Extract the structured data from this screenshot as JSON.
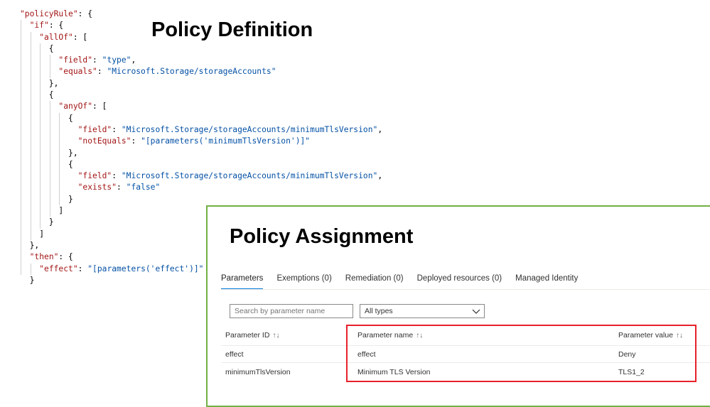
{
  "definition": {
    "title": "Policy Definition",
    "code_lines": [
      [
        {
          "t": "k",
          "v": "\"policyRule\""
        },
        {
          "t": "p",
          "v": ": {"
        }
      ],
      [
        {
          "t": "p",
          "v": "  "
        },
        {
          "t": "k",
          "v": "\"if\""
        },
        {
          "t": "p",
          "v": ": {"
        }
      ],
      [
        {
          "t": "p",
          "v": "    "
        },
        {
          "t": "k",
          "v": "\"allOf\""
        },
        {
          "t": "p",
          "v": ": ["
        }
      ],
      [
        {
          "t": "p",
          "v": "      {"
        }
      ],
      [
        {
          "t": "p",
          "v": "        "
        },
        {
          "t": "k",
          "v": "\"field\""
        },
        {
          "t": "p",
          "v": ": "
        },
        {
          "t": "s",
          "v": "\"type\""
        },
        {
          "t": "p",
          "v": ","
        }
      ],
      [
        {
          "t": "p",
          "v": "        "
        },
        {
          "t": "k",
          "v": "\"equals\""
        },
        {
          "t": "p",
          "v": ": "
        },
        {
          "t": "s",
          "v": "\"Microsoft.Storage/storageAccounts\""
        }
      ],
      [
        {
          "t": "p",
          "v": "      },"
        }
      ],
      [
        {
          "t": "p",
          "v": "      {"
        }
      ],
      [
        {
          "t": "p",
          "v": "        "
        },
        {
          "t": "k",
          "v": "\"anyOf\""
        },
        {
          "t": "p",
          "v": ": ["
        }
      ],
      [
        {
          "t": "p",
          "v": "          {"
        }
      ],
      [
        {
          "t": "p",
          "v": "            "
        },
        {
          "t": "k",
          "v": "\"field\""
        },
        {
          "t": "p",
          "v": ": "
        },
        {
          "t": "s",
          "v": "\"Microsoft.Storage/storageAccounts/minimumTlsVersion\""
        },
        {
          "t": "p",
          "v": ","
        }
      ],
      [
        {
          "t": "p",
          "v": "            "
        },
        {
          "t": "k",
          "v": "\"notEquals\""
        },
        {
          "t": "p",
          "v": ": "
        },
        {
          "t": "s",
          "v": "\"[parameters('minimumTlsVersion')]\""
        }
      ],
      [
        {
          "t": "p",
          "v": "          },"
        }
      ],
      [
        {
          "t": "p",
          "v": "          {"
        }
      ],
      [
        {
          "t": "p",
          "v": "            "
        },
        {
          "t": "k",
          "v": "\"field\""
        },
        {
          "t": "p",
          "v": ": "
        },
        {
          "t": "s",
          "v": "\"Microsoft.Storage/storageAccounts/minimumTlsVersion\""
        },
        {
          "t": "p",
          "v": ","
        }
      ],
      [
        {
          "t": "p",
          "v": "            "
        },
        {
          "t": "k",
          "v": "\"exists\""
        },
        {
          "t": "p",
          "v": ": "
        },
        {
          "t": "s",
          "v": "\"false\""
        }
      ],
      [
        {
          "t": "p",
          "v": "          }"
        }
      ],
      [
        {
          "t": "p",
          "v": "        ]"
        }
      ],
      [
        {
          "t": "p",
          "v": "      }"
        }
      ],
      [
        {
          "t": "p",
          "v": "    ]"
        }
      ],
      [
        {
          "t": "p",
          "v": "  },"
        }
      ],
      [
        {
          "t": "p",
          "v": "  "
        },
        {
          "t": "k",
          "v": "\"then\""
        },
        {
          "t": "p",
          "v": ": {"
        }
      ],
      [
        {
          "t": "p",
          "v": "    "
        },
        {
          "t": "k",
          "v": "\"effect\""
        },
        {
          "t": "p",
          "v": ": "
        },
        {
          "t": "s",
          "v": "\"[parameters('effect')]\""
        }
      ],
      [
        {
          "t": "p",
          "v": "  }"
        }
      ]
    ]
  },
  "assignment": {
    "title": "Policy Assignment",
    "tabs": [
      {
        "label": "Parameters",
        "active": true
      },
      {
        "label": "Exemptions (0)",
        "active": false
      },
      {
        "label": "Remediation (0)",
        "active": false
      },
      {
        "label": "Deployed resources (0)",
        "active": false
      },
      {
        "label": "Managed Identity",
        "active": false
      }
    ],
    "search": {
      "placeholder": "Search by parameter name",
      "value": ""
    },
    "filter": {
      "selected": "All types"
    },
    "sort_icon": "↑↓",
    "columns": {
      "id": "Parameter ID",
      "name": "Parameter name",
      "value": "Parameter value"
    },
    "rows": [
      {
        "id": "effect",
        "name": "effect",
        "value": "Deny"
      },
      {
        "id": "minimumTlsVersion",
        "name": "Minimum TLS Version",
        "value": "TLS1_2"
      }
    ],
    "colors": {
      "panel_border": "#72b043",
      "highlight_border": "#e8202a",
      "active_tab": "#0078d4"
    }
  }
}
